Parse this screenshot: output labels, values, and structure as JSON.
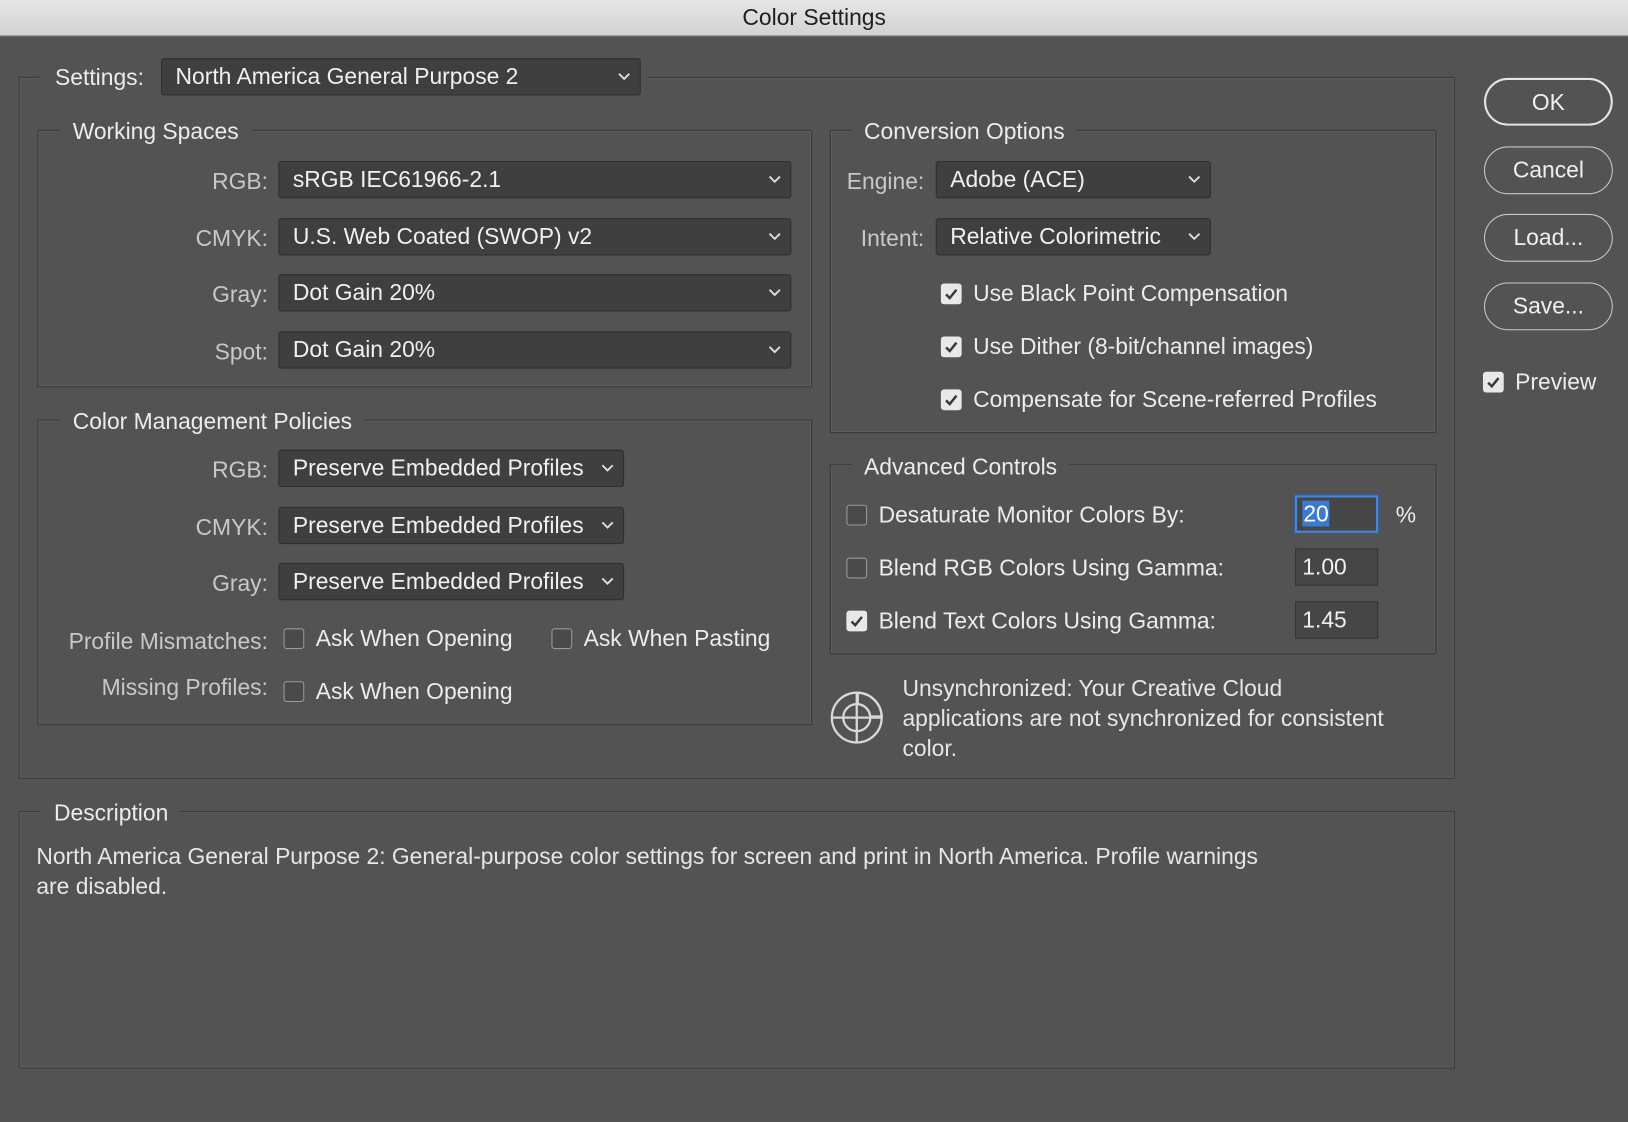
{
  "window": {
    "title": "Color Settings"
  },
  "settings": {
    "label": "Settings:",
    "value": "North America General Purpose 2"
  },
  "working_spaces": {
    "legend": "Working Spaces",
    "rgb": {
      "label": "RGB:",
      "value": "sRGB IEC61966-2.1"
    },
    "cmyk": {
      "label": "CMYK:",
      "value": "U.S. Web Coated (SWOP) v2"
    },
    "gray": {
      "label": "Gray:",
      "value": "Dot Gain 20%"
    },
    "spot": {
      "label": "Spot:",
      "value": "Dot Gain 20%"
    }
  },
  "policies": {
    "legend": "Color Management Policies",
    "rgb": {
      "label": "RGB:",
      "value": "Preserve Embedded Profiles"
    },
    "cmyk": {
      "label": "CMYK:",
      "value": "Preserve Embedded Profiles"
    },
    "gray": {
      "label": "Gray:",
      "value": "Preserve Embedded Profiles"
    },
    "profile_mismatches": {
      "label": "Profile Mismatches:",
      "ask_opening": {
        "label": "Ask When Opening",
        "checked": false
      },
      "ask_pasting": {
        "label": "Ask When Pasting",
        "checked": false
      }
    },
    "missing_profiles": {
      "label": "Missing Profiles:",
      "ask_opening": {
        "label": "Ask When Opening",
        "checked": false
      }
    }
  },
  "conversion": {
    "legend": "Conversion Options",
    "engine": {
      "label": "Engine:",
      "value": "Adobe (ACE)"
    },
    "intent": {
      "label": "Intent:",
      "value": "Relative Colorimetric"
    },
    "black_point": {
      "label": "Use Black Point Compensation",
      "checked": true
    },
    "dither": {
      "label": "Use Dither (8-bit/channel images)",
      "checked": true
    },
    "scene_referred": {
      "label": "Compensate for Scene-referred Profiles",
      "checked": true
    }
  },
  "advanced": {
    "legend": "Advanced Controls",
    "desaturate": {
      "label": "Desaturate Monitor Colors By:",
      "checked": false,
      "value": "20",
      "unit": "%"
    },
    "blend_rgb": {
      "label": "Blend RGB Colors Using Gamma:",
      "checked": false,
      "value": "1.00"
    },
    "blend_text": {
      "label": "Blend Text Colors Using Gamma:",
      "checked": true,
      "value": "1.45"
    }
  },
  "sync": {
    "icon": "sync-status-icon",
    "line1": "Unsynchronized: Your Creative Cloud",
    "line2": "applications are not synchronized for consistent",
    "line3": "color."
  },
  "description": {
    "legend": "Description",
    "line1": "North America General Purpose 2:  General-purpose color settings for screen and print in North America. Profile warnings",
    "line2": "are disabled."
  },
  "buttons": {
    "ok": "OK",
    "cancel": "Cancel",
    "load": "Load...",
    "save": "Save..."
  },
  "preview": {
    "label": "Preview",
    "checked": true
  },
  "colors": {
    "background": "#535353",
    "field": "#3f3f3f",
    "focus": "#4a86d6",
    "text": "#ececec"
  }
}
